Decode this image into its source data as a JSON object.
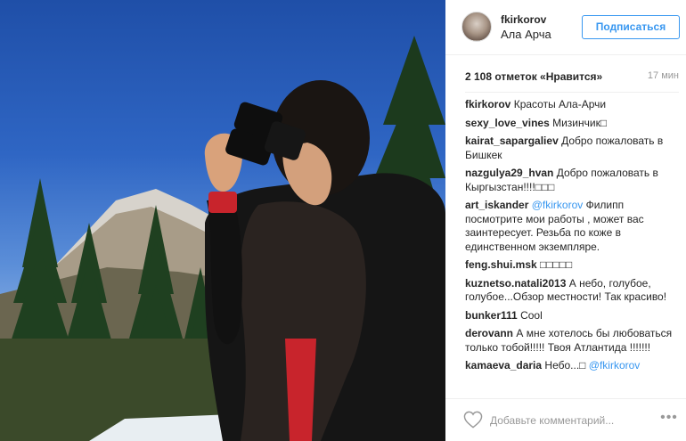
{
  "post": {
    "image_alt": "Man with binoculars in mountains",
    "username": "fkirkorov",
    "location": "Ала Арча",
    "follow_label": "Подписаться",
    "likes_text": "2 108 отметок «Нравится»",
    "time_ago": "17 мин"
  },
  "comments": [
    {
      "author": "fkirkorov",
      "text": "Красоты Ала-Арчи"
    },
    {
      "author": "sexy_love_vines",
      "text": "Мизинчик□"
    },
    {
      "author": "kairat_sapargaliev",
      "text": "Добро пожаловать в Бишкек"
    },
    {
      "author": "nazgulya29_hvan",
      "text": "Добро пожаловать в Кыргызстан!!!!□□□"
    },
    {
      "author": "art_iskander",
      "mention": "@fkirkorov",
      "text": "Филипп посмотрите мои работы , может вас заинтересует. Резьба по коже в единственном экземпляре."
    },
    {
      "author": "feng.shui.msk",
      "text": "□□□□□"
    },
    {
      "author": "kuznetso.natali2013",
      "text": "А небо, голубое, голубое...Обзор местности! Так красиво!"
    },
    {
      "author": "bunker111",
      "text": "Cool"
    },
    {
      "author": "derovann",
      "text": "А мне хотелось бы любоваться только тобой!!!!! Твоя Атлантида !!!!!!!"
    },
    {
      "author": "kamaeva_daria",
      "text": "Небо...□",
      "mention": "@fkirkorov"
    }
  ],
  "footer": {
    "heart_icon": "heart-outline-icon",
    "comment_placeholder": "Добавьте комментарий...",
    "more_icon": "more-options-icon",
    "more_label": "•••"
  },
  "colors": {
    "accent": "#3897f0",
    "sky_top": "#1f4fa8",
    "text": "#262626",
    "muted": "#999999"
  }
}
